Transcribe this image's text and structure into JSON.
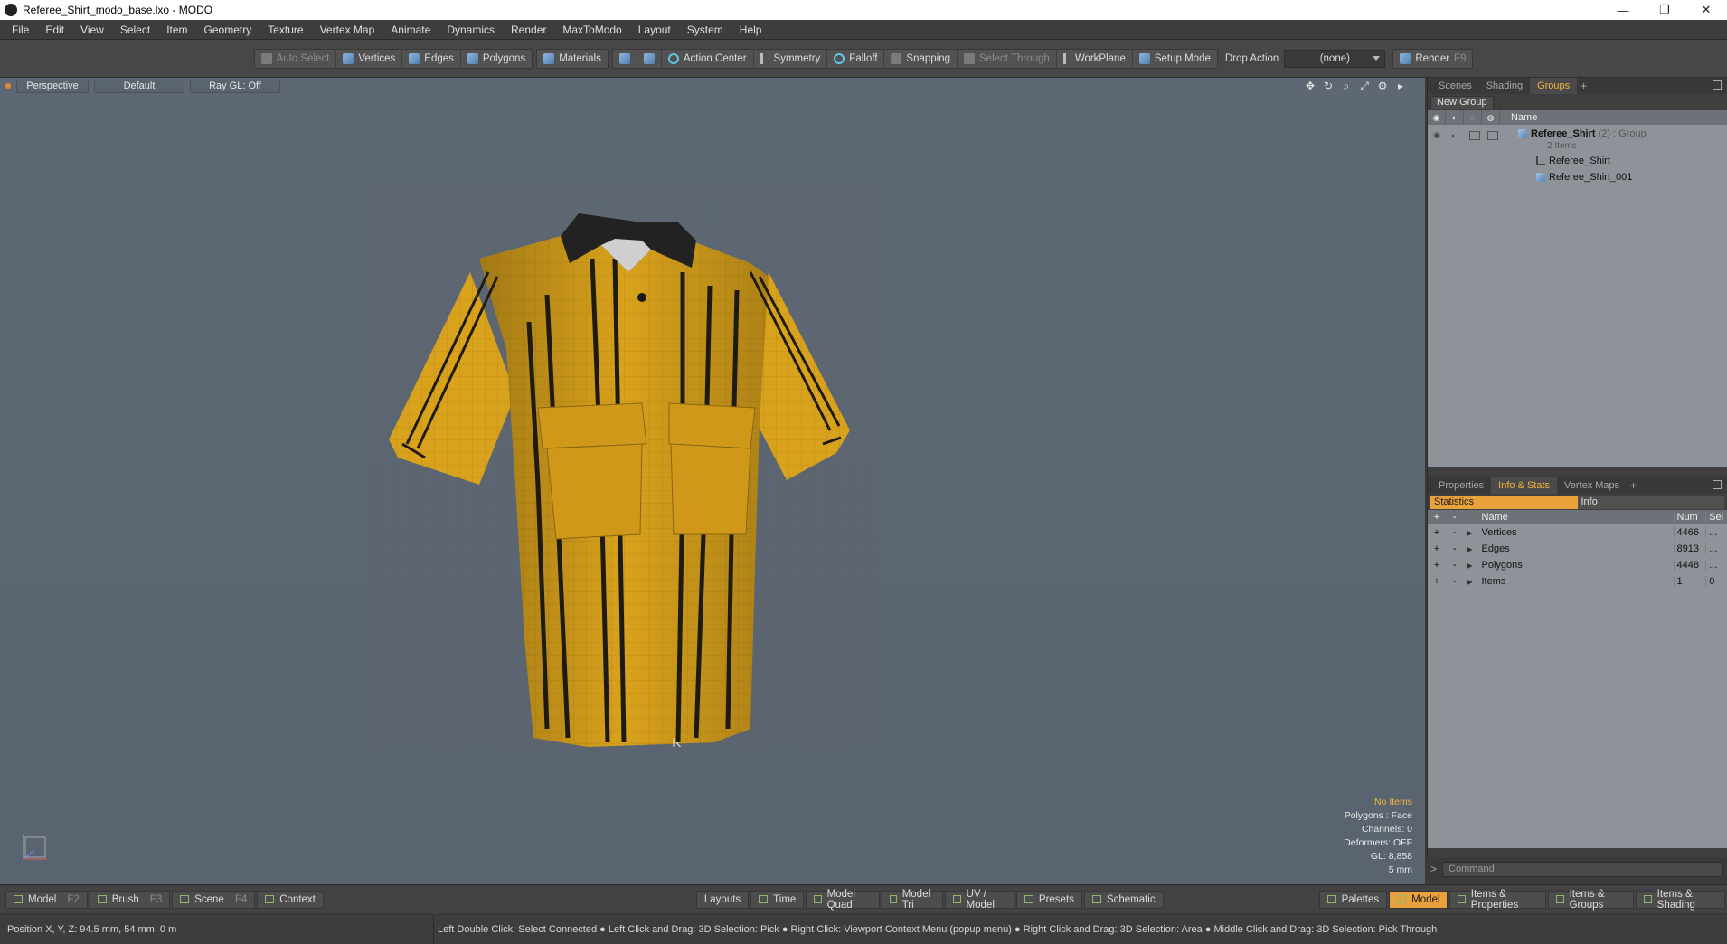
{
  "window": {
    "title": "Referee_Shirt_modo_base.lxo - MODO",
    "controls": [
      "—",
      "❐",
      "✕"
    ]
  },
  "menu": [
    "File",
    "Edit",
    "View",
    "Select",
    "Item",
    "Geometry",
    "Texture",
    "Vertex Map",
    "Animate",
    "Dynamics",
    "Render",
    "MaxToModo",
    "Layout",
    "System",
    "Help"
  ],
  "toolbar": {
    "auto_select": "Auto Select",
    "vertices": "Vertices",
    "edges": "Edges",
    "polygons": "Polygons",
    "materials": "Materials",
    "action_center": "Action Center",
    "symmetry": "Symmetry",
    "falloff": "Falloff",
    "snapping": "Snapping",
    "select_through": "Select Through",
    "workplane": "WorkPlane",
    "setup_mode": "Setup Mode",
    "drop_action_label": "Drop Action",
    "drop_action_value": "(none)",
    "render": "Render",
    "render_key": "F9"
  },
  "viewport": {
    "view": "Perspective",
    "shading": "Default",
    "raygl": "Ray GL: Off",
    "info": {
      "items": "No Items",
      "polygons": "Polygons : Face",
      "channels": "Channels: 0",
      "deformers": "Deformers: OFF",
      "gl": "GL: 8,858",
      "unit": "5 mm"
    },
    "colors": {
      "shirt": "#d9a21c",
      "stripe": "#1e1b14",
      "collar": "#222222",
      "bg": "#5c6672"
    }
  },
  "groups_panel": {
    "tabs": [
      "Scenes",
      "Shading",
      "Groups"
    ],
    "active_tab": "Groups",
    "new_group": "New Group",
    "column_name": "Name",
    "group": {
      "name": "Referee_Shirt",
      "count": "(2)",
      "type": ": Group",
      "items": "2 Items"
    },
    "children": [
      "Referee_Shirt",
      "Referee_Shirt_001"
    ]
  },
  "stats_panel": {
    "tabs": [
      "Properties",
      "Info & Stats",
      "Vertex Maps"
    ],
    "active_tab": "Info & Stats",
    "sub_tabs": [
      "Statistics",
      "Info"
    ],
    "columns": {
      "name": "Name",
      "num": "Num",
      "sel": "Sel"
    },
    "rows": [
      {
        "name": "Vertices",
        "num": "4466",
        "sel": "..."
      },
      {
        "name": "Edges",
        "num": "8913",
        "sel": "..."
      },
      {
        "name": "Polygons",
        "num": "4448",
        "sel": "..."
      },
      {
        "name": "Items",
        "num": "1",
        "sel": "0"
      }
    ]
  },
  "command": {
    "placeholder": "Command",
    "prompt": ">"
  },
  "bottombar": {
    "left": [
      {
        "label": "Model",
        "key": "F2"
      },
      {
        "label": "Brush",
        "key": "F3"
      },
      {
        "label": "Scene",
        "key": "F4"
      },
      {
        "label": "Context",
        "key": ""
      }
    ],
    "center": [
      "Layouts",
      "Time",
      "Model Quad",
      "Model Tri",
      "UV / Model",
      "Presets",
      "Schematic"
    ],
    "right": [
      "Palettes",
      "Model",
      "Items & Properties",
      "Items & Groups",
      "Items & Shading"
    ]
  },
  "status": {
    "position": "Position X, Y, Z:  94.5 mm, 54 mm, 0 m",
    "hints": "Left Double Click: Select Connected ● Left Click and Drag: 3D Selection: Pick ● Right Click: Viewport Context Menu (popup menu) ● Right Click and Drag: 3D Selection: Area ● Middle Click and Drag: 3D Selection: Pick Through"
  }
}
